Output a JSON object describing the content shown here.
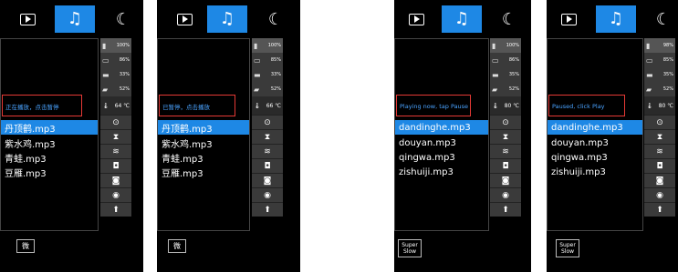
{
  "panels": [
    {
      "status_text": "正在播放，点击暂停",
      "songs": [
        "丹顶鹤.mp3",
        "紫水鸡.mp3",
        "青蛙.mp3",
        "豆雁.mp3"
      ],
      "selected_index": 0,
      "battery": [
        "100%",
        "86%",
        "33%",
        "52%"
      ],
      "temperature": "64 ℃",
      "bottom_button": "微"
    },
    {
      "status_text": "已暂停，点击播放",
      "songs": [
        "丹顶鹤.mp3",
        "紫水鸡.mp3",
        "青蛙.mp3",
        "豆雁.mp3"
      ],
      "selected_index": 0,
      "battery": [
        "100%",
        "85%",
        "33%",
        "52%"
      ],
      "temperature": "66 ℃",
      "bottom_button": "微"
    },
    {
      "status_text": "Playing now, tap Pause",
      "songs": [
        "dandinghe.mp3",
        "douyan.mp3",
        "qingwa.mp3",
        "zishuiji.mp3"
      ],
      "selected_index": 0,
      "battery": [
        "100%",
        "86%",
        "35%",
        "52%"
      ],
      "temperature": "80 ℃",
      "bottom_button": "Super Slow"
    },
    {
      "status_text": "Paused, click Play",
      "songs": [
        "dandinghe.mp3",
        "douyan.mp3",
        "qingwa.mp3",
        "zishuiji.mp3"
      ],
      "selected_index": 0,
      "battery": [
        "98%",
        "85%",
        "35%",
        "52%"
      ],
      "temperature": "80 ℃",
      "bottom_button": "Super Slow"
    }
  ],
  "icons": {
    "tab_play": "play-icon",
    "tab_music": "music-note-icon",
    "tab_moon": "moon-icon",
    "signal": "signal-icon",
    "battery": "battery-icon",
    "thermometer": "thermometer-icon",
    "camera": "camera-icon",
    "upload": "upload-icon"
  },
  "colors": {
    "accent": "#1e88e5",
    "highlight_box": "#e53935",
    "status_text": "#4aa3ff"
  }
}
